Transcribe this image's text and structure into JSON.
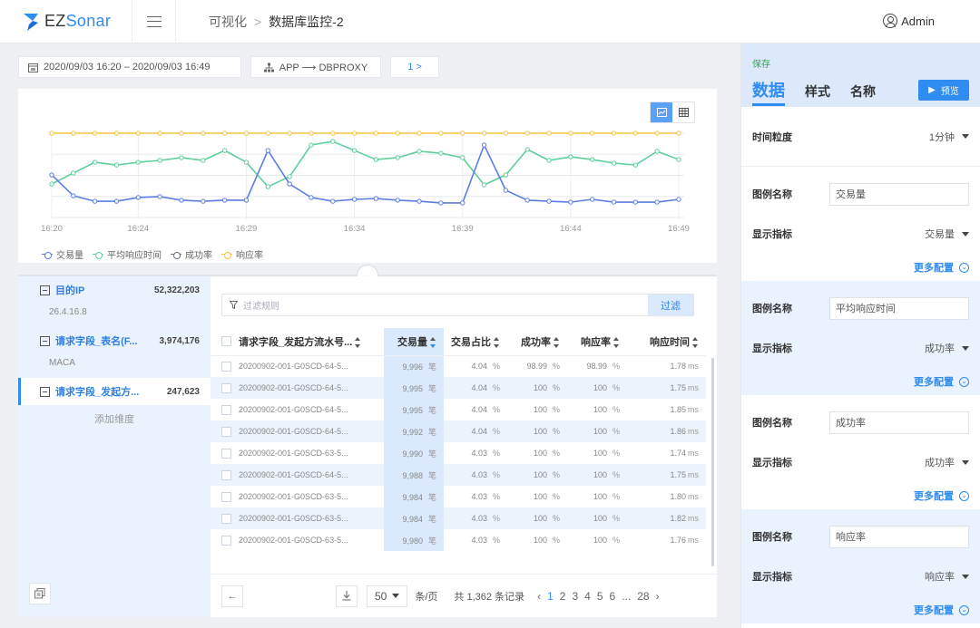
{
  "app": {
    "brand_prefix": "EZ",
    "brand_suffix": "Sonar"
  },
  "breadcrumb": {
    "parent": "可视化",
    "separator": ">",
    "current": "数据库监控-2"
  },
  "user": {
    "name": "Admin"
  },
  "filters": {
    "time_range": "2020/09/03 16:20 – 2020/09/03 16:49",
    "relation": "APP ⟶ DBPROXY",
    "page_chip": "1 >"
  },
  "chart_data": {
    "type": "line",
    "title": "",
    "xlabel": "",
    "ylabel": "",
    "x_ticks": [
      "16:20",
      "16:24",
      "16:29",
      "16:34",
      "16:39",
      "16:44",
      "16:49"
    ],
    "x": [
      "16:20",
      "16:21",
      "16:22",
      "16:23",
      "16:24",
      "16:25",
      "16:26",
      "16:27",
      "16:28",
      "16:29",
      "16:30",
      "16:31",
      "16:32",
      "16:33",
      "16:34",
      "16:35",
      "16:36",
      "16:37",
      "16:38",
      "16:39",
      "16:40",
      "16:41",
      "16:42",
      "16:43",
      "16:44",
      "16:45",
      "16:46",
      "16:47",
      "16:48",
      "16:49"
    ],
    "y_note": "no y-axis labels shown; values are relative to 4 gridline bands (0 = bottom, 4 = top)",
    "ylim": [
      0,
      4
    ],
    "grid": true,
    "legend_position": "bottom-left",
    "series": [
      {
        "name": "交易量",
        "color": "#5b7ee5",
        "values": [
          2.02,
          1.03,
          0.77,
          0.77,
          0.95,
          0.99,
          0.82,
          0.77,
          0.82,
          0.82,
          3.18,
          1.59,
          0.95,
          0.77,
          0.86,
          0.9,
          0.82,
          0.77,
          0.69,
          0.69,
          3.44,
          1.29,
          0.82,
          0.77,
          0.73,
          0.86,
          0.73,
          0.73,
          0.73,
          0.86
        ]
      },
      {
        "name": "平均响应时间",
        "color": "#5fcf9c",
        "values": [
          1.59,
          2.11,
          2.62,
          2.49,
          2.62,
          2.71,
          2.84,
          2.71,
          3.18,
          2.62,
          1.46,
          1.94,
          3.44,
          3.61,
          3.18,
          2.75,
          2.84,
          3.14,
          3.05,
          2.84,
          1.55,
          2.02,
          3.23,
          2.71,
          2.88,
          2.75,
          2.58,
          2.49,
          3.14,
          2.75
        ]
      },
      {
        "name": "成功率",
        "color": "#6a7385",
        "values": []
      },
      {
        "name": "响应率",
        "color": "#f5c342",
        "values": [
          4,
          4,
          4,
          4,
          4,
          4,
          4,
          4,
          4,
          4,
          4,
          4,
          4,
          4,
          4,
          4,
          4,
          4,
          4,
          4,
          4,
          4,
          4,
          4,
          4,
          4,
          4,
          4,
          4,
          4
        ]
      }
    ]
  },
  "dimensions": {
    "items": [
      {
        "name": "目的IP",
        "value": "52,322,203",
        "sub": "26.4.16.8"
      },
      {
        "name": "请求字段_表名(F...",
        "value": "3,974,176",
        "sub": "MACA"
      },
      {
        "name": "请求字段_发起方...",
        "value": "247,623",
        "sub": ""
      }
    ],
    "add_label": "添加维度"
  },
  "table": {
    "filter_placeholder": "过滤规则",
    "filter_button": "过滤",
    "columns": [
      "请求字段_发起方流水号...",
      "交易量",
      "交易占比",
      "成功率",
      "响应率",
      "响应时间"
    ],
    "rows": [
      {
        "id": "20200902-001-G0SCD-64-5...",
        "volume": "9,996",
        "volume_unit": "笔",
        "share": "4.04",
        "success": "98.99",
        "response": "98.99",
        "time": "1.78",
        "time_unit": "ms"
      },
      {
        "id": "20200902-001-G0SCD-64-5...",
        "volume": "9,995",
        "volume_unit": "笔",
        "share": "4.04",
        "success": "100",
        "response": "100",
        "time": "1.75",
        "time_unit": "ms"
      },
      {
        "id": "20200902-001-G0SCD-64-5...",
        "volume": "9,995",
        "volume_unit": "笔",
        "share": "4.04",
        "success": "100",
        "response": "100",
        "time": "1.85",
        "time_unit": "ms"
      },
      {
        "id": "20200902-001-G0SCD-64-5...",
        "volume": "9,992",
        "volume_unit": "笔",
        "share": "4.04",
        "success": "100",
        "response": "100",
        "time": "1.86",
        "time_unit": "ms"
      },
      {
        "id": "20200902-001-G0SCD-63-5...",
        "volume": "9,990",
        "volume_unit": "笔",
        "share": "4.03",
        "success": "100",
        "response": "100",
        "time": "1.74",
        "time_unit": "ms"
      },
      {
        "id": "20200902-001-G0SCD-64-5...",
        "volume": "9,988",
        "volume_unit": "笔",
        "share": "4.03",
        "success": "100",
        "response": "100",
        "time": "1.75",
        "time_unit": "ms"
      },
      {
        "id": "20200902-001-G0SCD-63-5...",
        "volume": "9,984",
        "volume_unit": "笔",
        "share": "4.03",
        "success": "100",
        "response": "100",
        "time": "1.80",
        "time_unit": "ms"
      },
      {
        "id": "20200902-001-G0SCD-63-5...",
        "volume": "9,984",
        "volume_unit": "笔",
        "share": "4.03",
        "success": "100",
        "response": "100",
        "time": "1.82",
        "time_unit": "ms"
      },
      {
        "id": "20200902-001-G0SCD-63-5...",
        "volume": "9,980",
        "volume_unit": "笔",
        "share": "4.03",
        "success": "100",
        "response": "100",
        "time": "1.76",
        "time_unit": "ms"
      }
    ],
    "percent_unit": "%",
    "pagination": {
      "page_size": "50",
      "page_size_unit": "条/页",
      "total": "共 1,362 条记录",
      "pages": [
        "1",
        "2",
        "3",
        "4",
        "5",
        "6",
        "...",
        "28"
      ],
      "current": "1"
    }
  },
  "panel": {
    "save": "保存",
    "tabs": [
      "数据",
      "样式",
      "名称"
    ],
    "preview": "预览",
    "granularity_label": "时间粒度",
    "granularity_value": "1分钟",
    "legend_label": "图例名称",
    "metric_label": "显示指标",
    "more_label": "更多配置",
    "groups": [
      {
        "legend": "交易量",
        "metric": "交易量"
      },
      {
        "legend": "平均响应时间",
        "metric": "成功率"
      },
      {
        "legend": "成功率",
        "metric": "成功率"
      },
      {
        "legend": "响应率",
        "metric": "响应率"
      }
    ]
  }
}
